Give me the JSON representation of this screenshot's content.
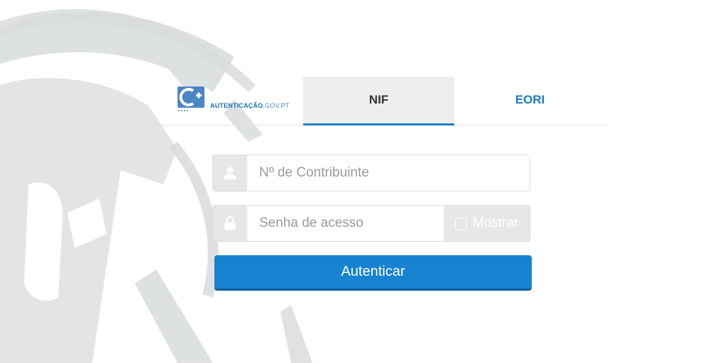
{
  "logo": {
    "brand_strong": "AUTENTICAÇÃO",
    "brand_light": ".GOV.PT",
    "icon": "autenticacao-gov-logo-icon"
  },
  "tabs": [
    {
      "label": "NIF",
      "active": true
    },
    {
      "label": "EORI",
      "active": false
    }
  ],
  "form": {
    "nif_placeholder": "Nº de Contribuinte",
    "nif_value": "",
    "nif_icon": "user-icon",
    "password_placeholder": "Senha de acesso",
    "password_value": "",
    "password_icon": "lock-icon",
    "show_label": "Mostrar",
    "show_checked": false,
    "submit_label": "Autenticar"
  },
  "colors": {
    "accent": "#1682d0",
    "tab_active_bg": "#eeeeee",
    "tab_inactive_text": "#1b79bf",
    "icon_bg": "#e7e7e7"
  }
}
